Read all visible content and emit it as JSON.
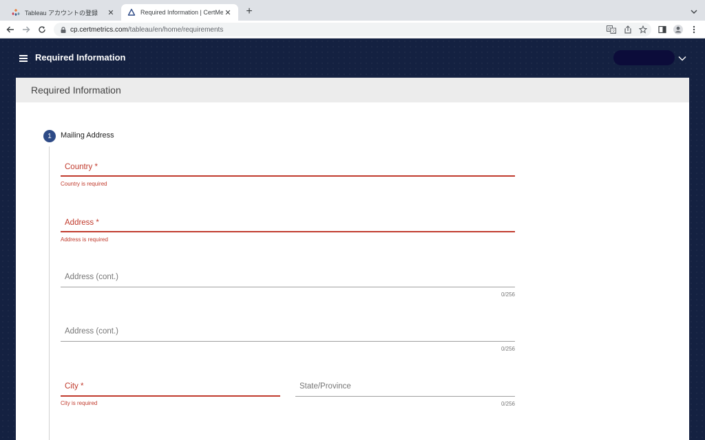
{
  "browser": {
    "tabs": [
      {
        "title": "Tableau アカウントの登録",
        "active": false
      },
      {
        "title": "Required Information | CertMetrics",
        "active": true
      }
    ],
    "url_host": "cp.certmetrics.com",
    "url_path": "/tableau/en/home/requirements"
  },
  "app": {
    "header_title": "Required Information",
    "card_title": "Required Information"
  },
  "step": {
    "number": "1",
    "title": "Mailing Address"
  },
  "fields": {
    "country": {
      "label": "Country *",
      "error": "Country is required"
    },
    "address": {
      "label": "Address *",
      "error": "Address is required"
    },
    "address2": {
      "label": "Address (cont.)",
      "counter": "0/256"
    },
    "address3": {
      "label": "Address (cont.)",
      "counter": "0/256"
    },
    "city": {
      "label": "City *",
      "error": "City is required"
    },
    "state": {
      "label": "State/Province",
      "counter": "0/256"
    }
  },
  "colors": {
    "app_background": "#142141",
    "error": "#c0392b",
    "step_badge": "#2d4a86"
  }
}
